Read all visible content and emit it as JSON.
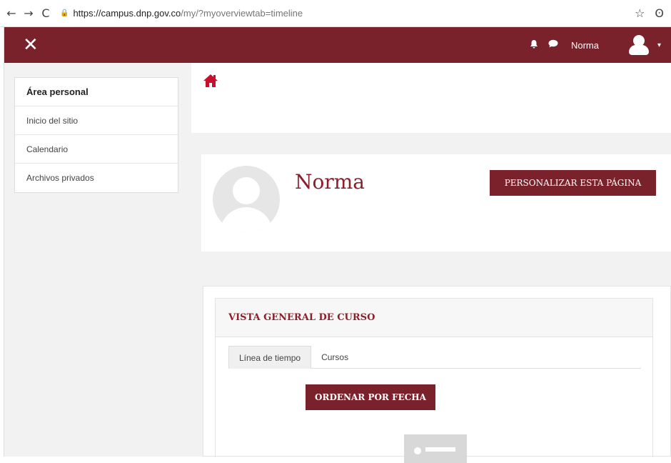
{
  "browser": {
    "back_icon": "←",
    "forward_icon": "→",
    "reload_icon": "C",
    "url_host": "https://campus.dnp.gov.co",
    "url_path": "/my/?myoverviewtab=timeline",
    "star_icon": "☆",
    "account_icon": "ʘ"
  },
  "navbar": {
    "close_icon": "✕",
    "bell_icon": "🔔",
    "chat_icon": "💬",
    "username": "Norma",
    "caret": "▾",
    "color": "#7a222b"
  },
  "sidebar": {
    "items": [
      {
        "label": "Área personal",
        "active": true
      },
      {
        "label": "Inicio del sitio"
      },
      {
        "label": "Calendario"
      },
      {
        "label": "Archivos privados"
      }
    ]
  },
  "profile": {
    "name": "Norma",
    "customize_button": "PERSONALIZAR ESTA PÁGINA"
  },
  "overview": {
    "title": "VISTA GENERAL DE CURSO",
    "tabs": [
      {
        "label": "Línea de tiempo",
        "active": true
      },
      {
        "label": "Cursos"
      }
    ],
    "sort_button": "ORDENAR POR FECHA"
  }
}
